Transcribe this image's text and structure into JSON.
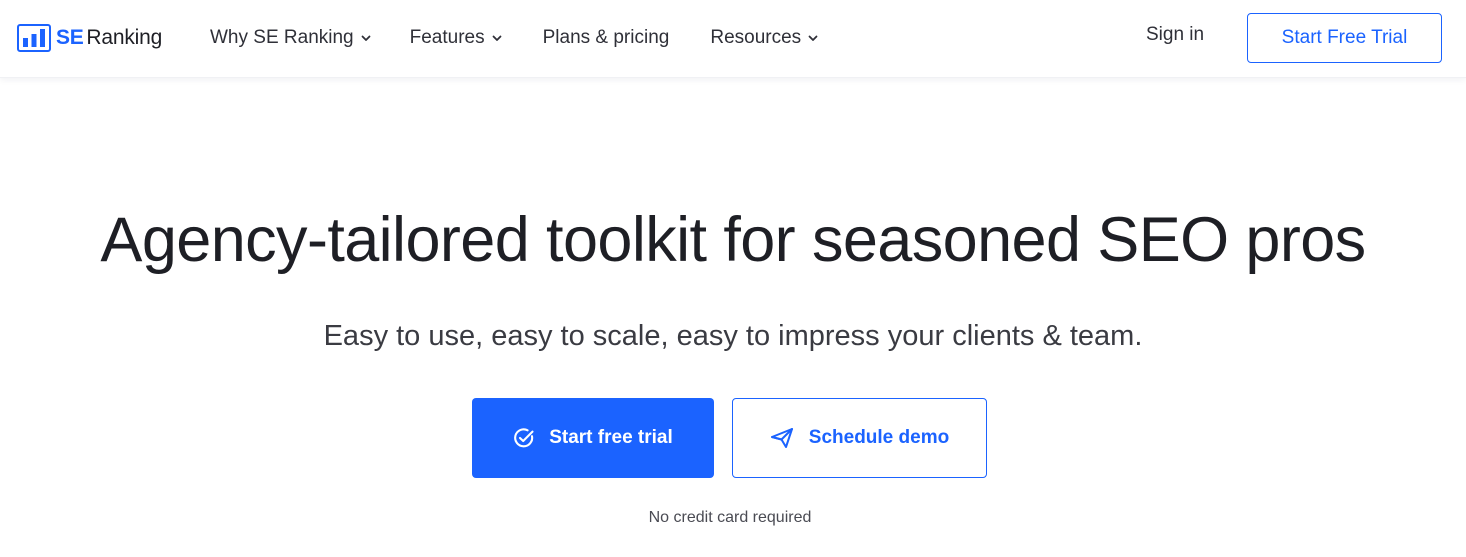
{
  "header": {
    "logo": {
      "brand_se": "SE",
      "brand_ranking": "Ranking",
      "icon": "bar-chart-logo-icon"
    },
    "nav": [
      {
        "label": "Why SE Ranking",
        "has_dropdown": true
      },
      {
        "label": "Features",
        "has_dropdown": true
      },
      {
        "label": "Plans & pricing",
        "has_dropdown": false
      },
      {
        "label": "Resources",
        "has_dropdown": true
      }
    ],
    "signin_label": "Sign in",
    "trial_label": "Start Free Trial"
  },
  "hero": {
    "title": "Agency-tailored toolkit for seasoned SEO pros",
    "subtitle": "Easy to use, easy to scale, easy to impress your clients & team.",
    "primary_button": {
      "label": "Start free trial",
      "icon": "check-circle-icon"
    },
    "secondary_button": {
      "label": "Schedule demo",
      "icon": "paper-plane-icon"
    },
    "note": "No credit card required"
  },
  "colors": {
    "accent": "#1b63ff",
    "text": "#1e1f25",
    "background": "#ffffff"
  }
}
